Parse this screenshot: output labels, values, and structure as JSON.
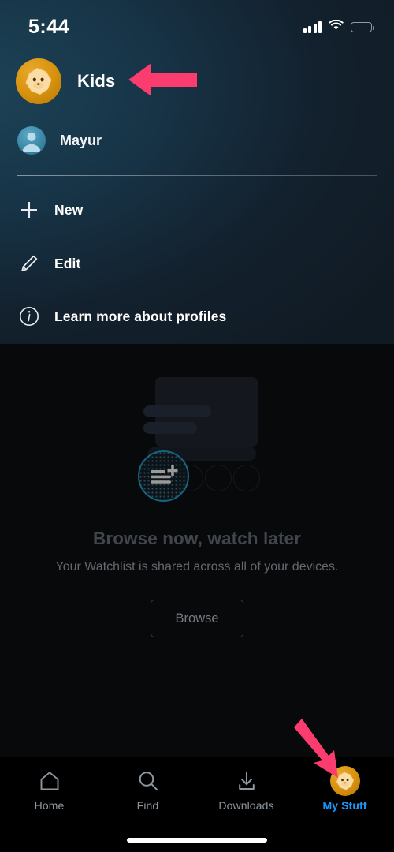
{
  "status_bar": {
    "time": "5:44",
    "signal_icon": "cellular-signal-icon",
    "wifi_icon": "wifi-icon",
    "battery_icon": "battery-low-icon",
    "battery_level_percent": 25,
    "battery_color": "#f6352e"
  },
  "profile_panel": {
    "current_profile": {
      "name": "Kids",
      "avatar_icon": "kids-star-avatar",
      "chevron_icon": "chevron-up-icon"
    },
    "other_profiles": [
      {
        "name": "Mayur",
        "avatar_icon": "user-avatar-icon"
      }
    ],
    "menu_items": [
      {
        "label": "New",
        "icon": "plus-icon"
      },
      {
        "label": "Edit",
        "icon": "pencil-icon"
      },
      {
        "label": "Learn more about profiles",
        "icon": "info-circle-icon"
      }
    ]
  },
  "main": {
    "illustration_icon": "add-to-watchlist-icon",
    "title": "Browse now, watch later",
    "subtitle": "Your Watchlist is shared across all of your devices.",
    "browse_button": "Browse"
  },
  "tab_bar": {
    "tabs": [
      {
        "label": "Home",
        "icon": "home-icon",
        "active": false
      },
      {
        "label": "Find",
        "icon": "search-icon",
        "active": false
      },
      {
        "label": "Downloads",
        "icon": "download-icon",
        "active": false
      },
      {
        "label": "My Stuff",
        "icon": "kids-star-avatar",
        "active": true
      }
    ],
    "active_color": "#1a9afe",
    "inactive_color": "#8d979f"
  },
  "annotations": {
    "arrow_color": "#fa3c6e",
    "arrows": [
      {
        "name": "arrow-to-profile-chevron",
        "direction": "left"
      },
      {
        "name": "arrow-to-my-stuff-tab",
        "direction": "down-right"
      }
    ]
  }
}
